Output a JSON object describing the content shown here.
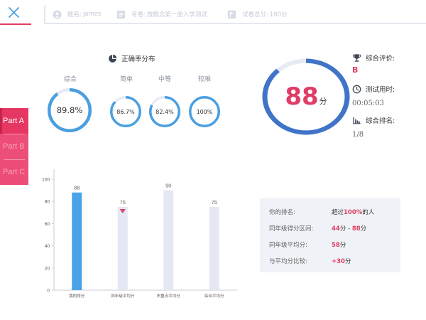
{
  "header": {
    "close_icon": "close-icon",
    "name_label": "姓名:",
    "name_value": "james",
    "exam_label": "考卷:",
    "exam_value": "按概念第一册入学测试",
    "score_label": "试卷总分:",
    "score_value": "100分"
  },
  "side_tabs": [
    {
      "label": "Part A",
      "active": true
    },
    {
      "label": "Part B",
      "active": false
    },
    {
      "label": "Part C",
      "active": false
    }
  ],
  "accuracy": {
    "title": "正确率分布",
    "items": [
      {
        "label": "综合",
        "value_text": "89.8%",
        "fraction": 0.898
      },
      {
        "label": "简单",
        "value_text": "86.7%",
        "fraction": 0.867
      },
      {
        "label": "中等",
        "value_text": "82.4%",
        "fraction": 0.824
      },
      {
        "label": "较难",
        "value_text": "100%",
        "fraction": 1.0
      }
    ]
  },
  "score": {
    "value": "88",
    "unit": "分",
    "fraction": 0.88
  },
  "stats": {
    "evaluation_label": "综合评价:",
    "evaluation_value": "B",
    "time_label": "测试用时:",
    "time_value": "00:05:03",
    "rank_label": "综合排名:",
    "rank_value": "1/8"
  },
  "colors": {
    "pink": "#e23c64",
    "ring_blue": "#4a9fe0",
    "big_ring_blue": "#3f74c8",
    "ring_track": "#e6ebf4",
    "bar_highlight": "#4aa3e8",
    "bar_normal": "#e4e8f3"
  },
  "chart_data": {
    "type": "bar",
    "categories": [
      "我的得分",
      "同年级平均分",
      "市重点平均分",
      "综合平均分"
    ],
    "values": [
      88,
      75,
      90,
      75
    ],
    "ylim": [
      0,
      100
    ],
    "yticks": [
      0,
      20,
      40,
      60,
      80,
      100
    ],
    "highlight_index": 0,
    "marker_index": 1,
    "marker": "red-down-triangle"
  },
  "ranking": {
    "rows": [
      {
        "label": "你的排名:",
        "parts": [
          {
            "t": "超过",
            "pink": false
          },
          {
            "t": "100%",
            "pink": true
          },
          {
            "t": "的人",
            "pink": false
          }
        ]
      },
      {
        "label": "同年级得分区间:",
        "parts": [
          {
            "t": "44",
            "pink": true
          },
          {
            "t": "分 - ",
            "pink": false
          },
          {
            "t": "88",
            "pink": true
          },
          {
            "t": "分",
            "pink": false
          }
        ]
      },
      {
        "label": "同年级平均分:",
        "parts": [
          {
            "t": "58",
            "pink": true
          },
          {
            "t": "分",
            "pink": false
          }
        ]
      },
      {
        "label": "与平均分比较:",
        "parts": [
          {
            "t": "+30",
            "pink": true
          },
          {
            "t": "分",
            "pink": false
          }
        ]
      }
    ]
  }
}
